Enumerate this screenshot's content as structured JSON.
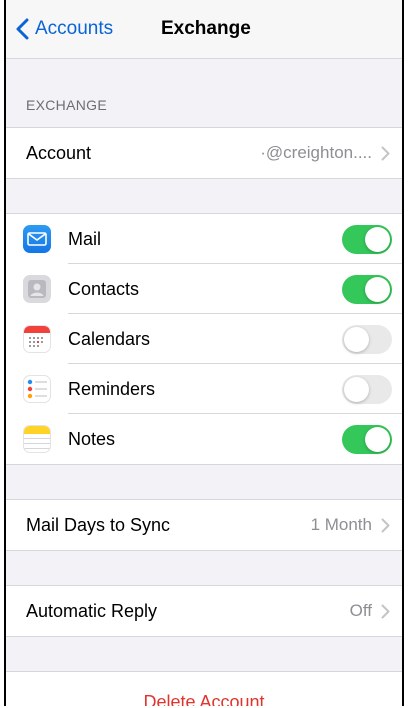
{
  "nav": {
    "back_label": "Accounts",
    "title": "Exchange"
  },
  "exchange_section": {
    "header": "EXCHANGE",
    "account_label": "Account",
    "account_value": "·@creighton...."
  },
  "services": [
    {
      "label": "Mail",
      "icon": "mail-icon",
      "on": true
    },
    {
      "label": "Contacts",
      "icon": "contacts-icon",
      "on": true
    },
    {
      "label": "Calendars",
      "icon": "calendar-icon",
      "on": false
    },
    {
      "label": "Reminders",
      "icon": "reminders-icon",
      "on": false
    },
    {
      "label": "Notes",
      "icon": "notes-icon",
      "on": true
    }
  ],
  "mail_days": {
    "label": "Mail Days to Sync",
    "value": "1 Month"
  },
  "auto_reply": {
    "label": "Automatic Reply",
    "value": "Off"
  },
  "delete_label": "Delete Account",
  "colors": {
    "accent": "#0a64d6",
    "toggle_on": "#34c759",
    "destructive": "#e0342c"
  }
}
